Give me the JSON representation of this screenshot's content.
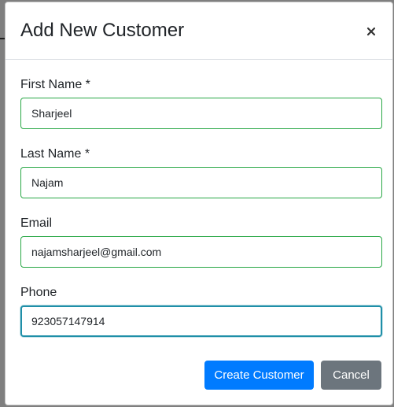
{
  "modal": {
    "title": "Add New Customer",
    "close_label": "×"
  },
  "form": {
    "first_name": {
      "label": "First Name *",
      "value": "Sharjeel"
    },
    "last_name": {
      "label": "Last Name *",
      "value": "Najam"
    },
    "email": {
      "label": "Email",
      "value": "najamsharjeel@gmail.com"
    },
    "phone": {
      "label": "Phone",
      "value": "923057147914"
    }
  },
  "footer": {
    "create_label": "Create Customer",
    "cancel_label": "Cancel"
  },
  "colors": {
    "primary": "#007bff",
    "secondary": "#6c757d",
    "valid_border": "#28a745",
    "focus_border": "#1f8fa8"
  },
  "icons": {
    "close": "close-icon"
  }
}
